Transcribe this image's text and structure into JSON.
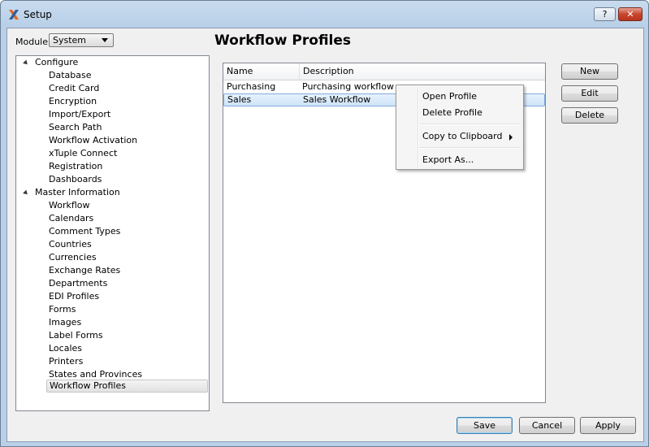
{
  "window": {
    "title": "Setup",
    "help_label": "?",
    "close_label": "✕",
    "accent": "#3a79c3"
  },
  "module": {
    "label": "Module:",
    "selected": "System"
  },
  "tree": {
    "groups": [
      {
        "label": "Configure",
        "items": [
          "Database",
          "Credit Card",
          "Encryption",
          "Import/Export",
          "Search Path",
          "Workflow Activation",
          "xTuple Connect",
          "Registration",
          "Dashboards"
        ]
      },
      {
        "label": "Master Information",
        "items": [
          "Workflow",
          "Calendars",
          "Comment Types",
          "Countries",
          "Currencies",
          "Exchange Rates",
          "Departments",
          "EDI Profiles",
          "Forms",
          "Images",
          "Label Forms",
          "Locales",
          "Printers",
          "States and Provinces",
          "Workflow Profiles"
        ]
      }
    ]
  },
  "main": {
    "heading": "Workflow Profiles",
    "columns": [
      "Name",
      "Description"
    ],
    "rows": [
      {
        "name": "Purchasing",
        "description": "Purchasing workflow"
      },
      {
        "name": "Sales",
        "description": "Sales Workflow"
      }
    ]
  },
  "side_buttons": {
    "new": "New",
    "edit": "Edit",
    "delete": "Delete"
  },
  "context_menu": {
    "open": "Open Profile",
    "delete": "Delete Profile",
    "copy": "Copy to Clipboard",
    "export": "Export As..."
  },
  "footer": {
    "save": "Save",
    "cancel": "Cancel",
    "apply": "Apply"
  }
}
